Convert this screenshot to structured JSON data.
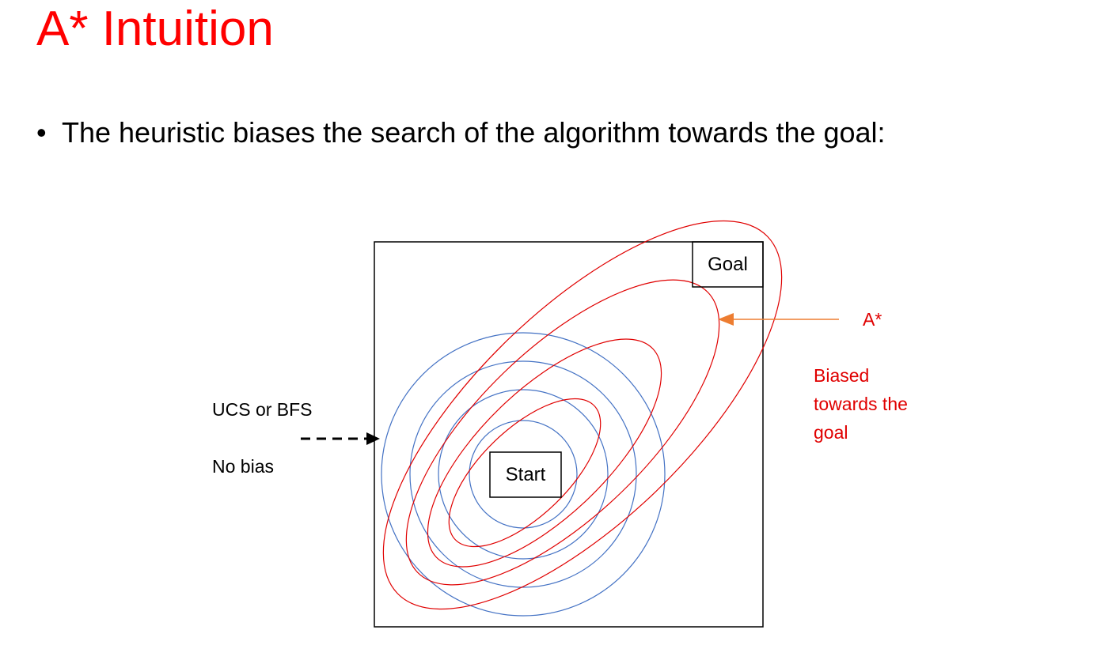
{
  "slide": {
    "title": "A* Intuition",
    "bullet": "The heuristic biases the search of the algorithm towards the goal:"
  },
  "diagram": {
    "goal_label": "Goal",
    "start_label": "Start",
    "left_label_top": "UCS or BFS",
    "left_label_bottom": "No bias",
    "astar_label": "A*",
    "biased_label_lines": [
      "Biased",
      "towards the",
      "goal"
    ],
    "colors": {
      "title": "#ff0000",
      "circles": "#4472c4",
      "ellipses": "#e00000",
      "astar_arrow": "#ed7d31",
      "bfs_arrow": "#000000",
      "biased_text": "#e00000"
    }
  }
}
